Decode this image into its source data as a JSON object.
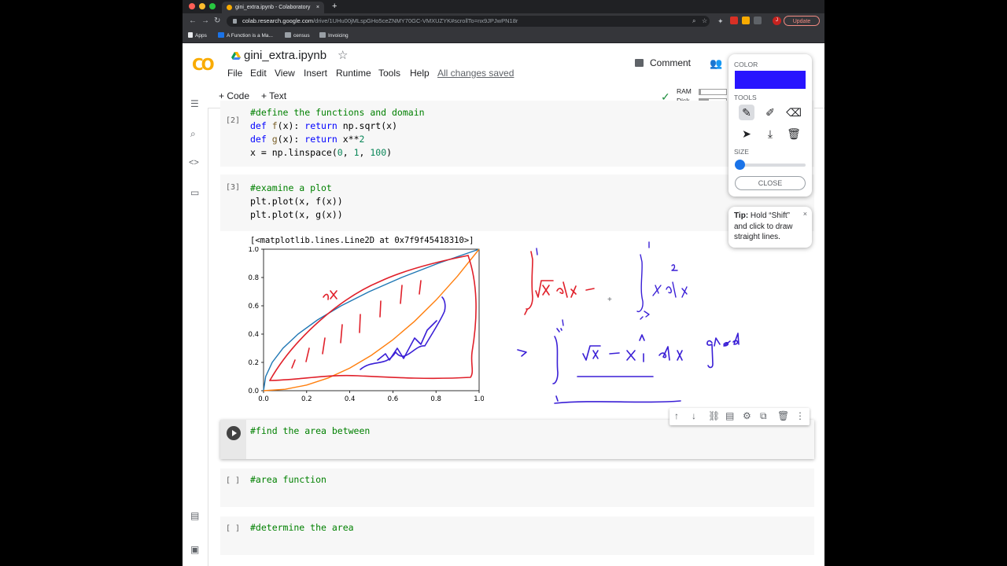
{
  "browser": {
    "tab_title": "gini_extra.ipynb - Colaboratory",
    "tab_close": "×",
    "new_tab": "+",
    "url_host": "colab.research.google.com",
    "url_path": "/drive/1UHu00jMLspGHo5ceZNMY70GC-VMXUZYK#scrollTo=nx9JPJwPN18r",
    "update_label": "Update",
    "avatar_letter": "J",
    "bookmarks": [
      {
        "label": "Apps",
        "color": "#e8eaed"
      },
      {
        "label": "A Function is a Ma...",
        "color": "#1a73e8"
      },
      {
        "label": "census",
        "color": "#9aa0a6"
      },
      {
        "label": "Invoicing",
        "color": "#9aa0a6"
      }
    ]
  },
  "header": {
    "logo": "CO",
    "notebook_name": "gini_extra.ipynb",
    "star": "☆",
    "menu": [
      "File",
      "Edit",
      "View",
      "Insert",
      "Runtime",
      "Tools",
      "Help"
    ],
    "saved_status": "All changes saved",
    "comment_label": "Comment"
  },
  "subbar": {
    "add_code": "+ Code",
    "add_text": "+ Text",
    "ram_label": "RAM",
    "disk_label": "Disk",
    "ram_usage": 0.06,
    "disk_usage": 0.35
  },
  "cells": {
    "c2": {
      "prompt": "[2]"
    },
    "c3": {
      "prompt": "[3]",
      "output": "[<matplotlib.lines.Line2D at 0x7f9f45418310>]"
    },
    "c4": {
      "code": "#find the area between"
    },
    "c5": {
      "prompt": "[ ]",
      "code": "#area function"
    },
    "c6": {
      "prompt": "[ ]",
      "code": "#determine the area"
    }
  },
  "chart_data": {
    "type": "line",
    "xlim": [
      0.0,
      1.0
    ],
    "ylim": [
      0.0,
      1.0
    ],
    "x_ticks": [
      "0.0",
      "0.2",
      "0.4",
      "0.6",
      "0.8",
      "1.0"
    ],
    "y_ticks": [
      "0.0",
      "0.2",
      "0.4",
      "0.6",
      "0.8",
      "1.0"
    ],
    "series": [
      {
        "color": "#1f77b4",
        "x": [
          0,
          0.01,
          0.04,
          0.09,
          0.16,
          0.25,
          0.36,
          0.49,
          0.64,
          0.81,
          1.0
        ],
        "y": [
          0,
          0.1,
          0.2,
          0.3,
          0.4,
          0.5,
          0.6,
          0.7,
          0.8,
          0.9,
          1.0
        ]
      },
      {
        "color": "#ff7f0e",
        "x": [
          0,
          0.1,
          0.2,
          0.3,
          0.4,
          0.5,
          0.6,
          0.7,
          0.8,
          0.9,
          1.0
        ],
        "y": [
          0,
          0.01,
          0.04,
          0.09,
          0.16,
          0.25,
          0.36,
          0.49,
          0.64,
          0.81,
          1.0
        ]
      }
    ],
    "grid": false
  },
  "annotations": {
    "sqrt_label": "√x",
    "grad_label": "grad"
  },
  "draw_popup": {
    "color_label": "COLOR",
    "color": "#2814ff",
    "tools_label": "TOOLS",
    "size_label": "SIZE",
    "close_label": "CLOSE",
    "tools": [
      "pencil-icon",
      "highlighter-icon",
      "eraser-icon",
      "pointer-icon",
      "download-icon",
      "trash-icon"
    ]
  },
  "tip": {
    "bold": "Tip:",
    "text": " Hold “Shift” and click to draw straight lines.",
    "close": "×"
  }
}
